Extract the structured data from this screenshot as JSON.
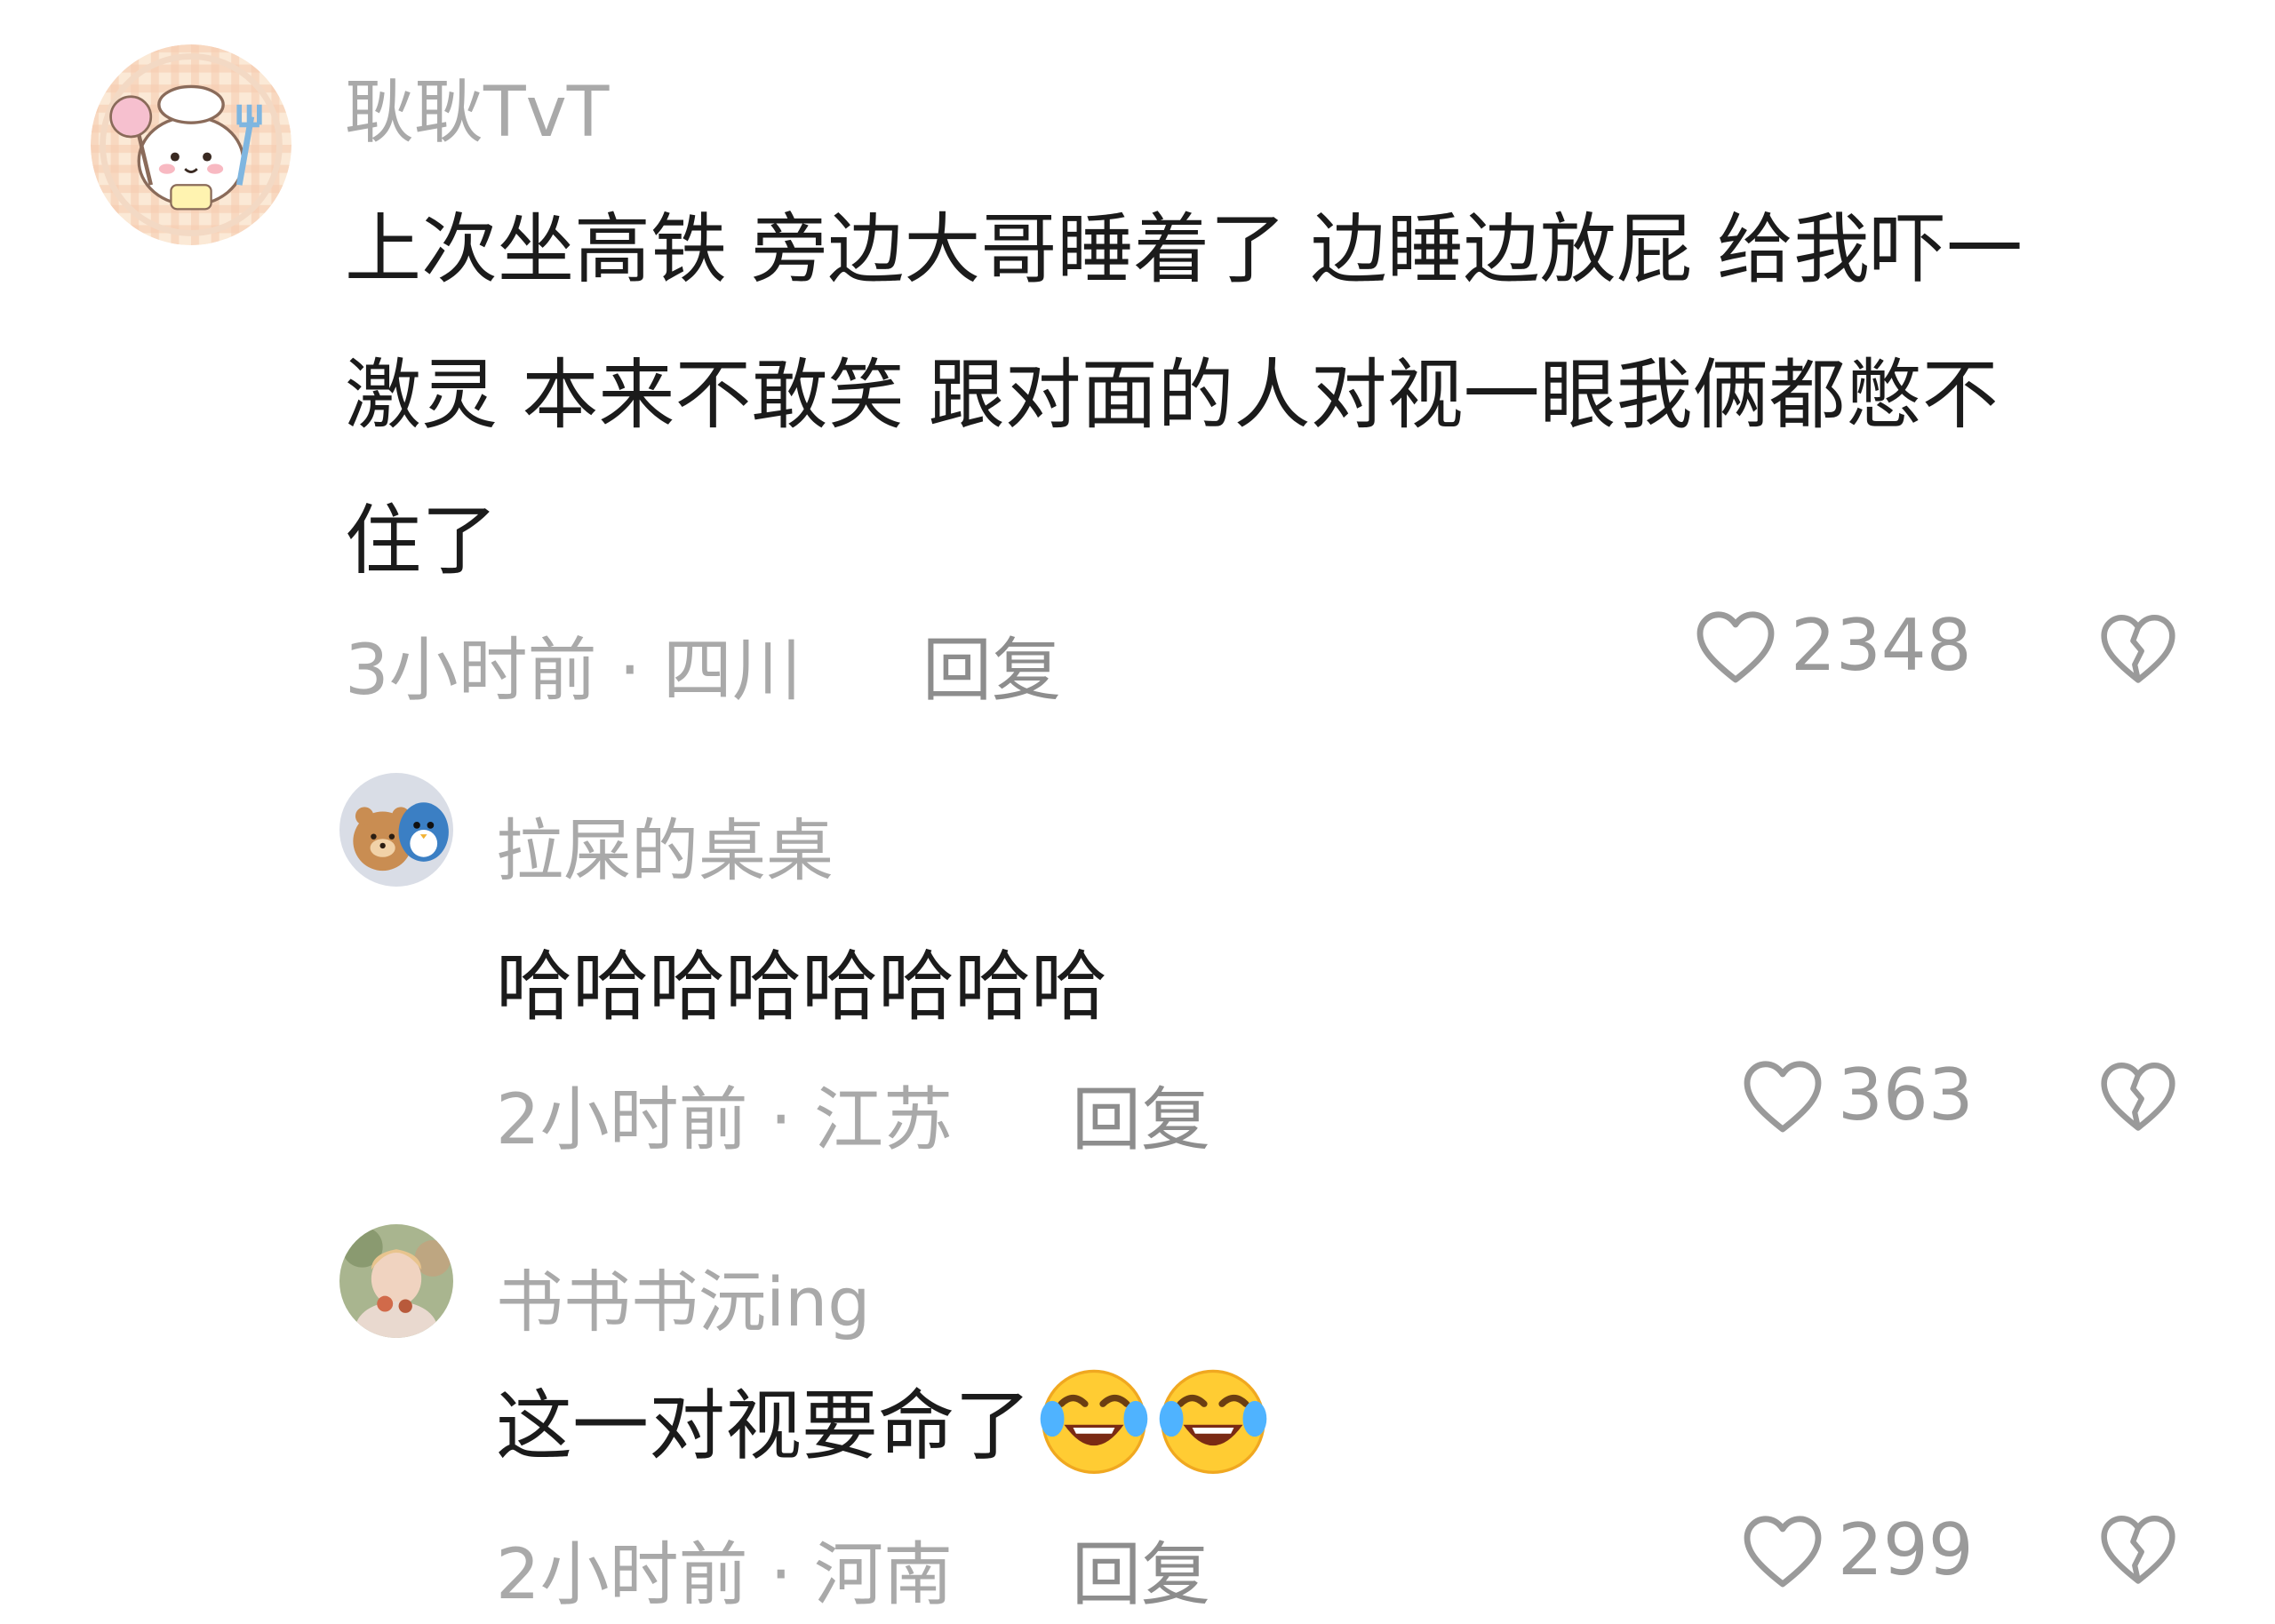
{
  "comments": [
    {
      "username": "耿耿TvT",
      "avatar_icon": "chef-bunny-avatar",
      "text_lines": [
        "上次坐高铁 旁边大哥睡着了 边睡边放屁 给我吓一",
        "激灵 本来不敢笑 跟对面的人对视一眼我俩都憋不",
        "住了"
      ],
      "meta": "3小时前 · 四川",
      "reply_label": "回复",
      "likes": "2348"
    },
    {
      "username": "拉屎的桌桌",
      "avatar_icon": "bear-and-bird-avatar",
      "text": "哈哈哈哈哈哈哈哈",
      "meta": "2小时前 · 江苏",
      "reply_label": "回复",
      "likes": "363"
    },
    {
      "username": "书书书沅ing",
      "avatar_icon": "photo-avatar",
      "text": "这一对视要命了",
      "emojis": [
        "laugh-cry-emoji",
        "laugh-cry-emoji"
      ],
      "meta": "2小时前 · 河南",
      "reply_label": "回复",
      "likes": "299"
    }
  ],
  "icons": {
    "like": "heart-outline-icon",
    "dislike": "broken-heart-icon"
  },
  "colors": {
    "text": "#1b1b1b",
    "secondary": "#a9a9a9",
    "reply": "#8d8d8d",
    "emoji_face": "#ffcc33"
  }
}
